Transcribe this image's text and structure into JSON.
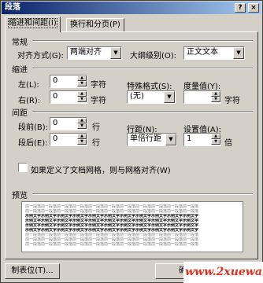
{
  "title": "段落",
  "window_buttons": {
    "help": "?",
    "close": "×"
  },
  "tabs": [
    {
      "label": "缩进和间距(I)"
    },
    {
      "label": "换行和分页(P)"
    }
  ],
  "general": {
    "heading": "常规",
    "alignment_label": "对齐方式(G):",
    "alignment_value": "两端对齐",
    "outline_label": "大纲级别(O):",
    "outline_value": "正文文本"
  },
  "indent": {
    "heading": "缩进",
    "left_label": "左(L):",
    "left_value": "0",
    "left_unit": "字符",
    "right_label": "右(R):",
    "right_value": "0",
    "right_unit": "字符",
    "special_label": "特殊格式(S):",
    "special_value": "(无)",
    "measure_label": "度量值(Y):",
    "measure_value": "",
    "measure_unit": "字符"
  },
  "spacing": {
    "heading": "间距",
    "before_label": "段前(B):",
    "before_value": "0",
    "before_unit": "行",
    "after_label": "段后(E):",
    "after_value": "0",
    "after_unit": "行",
    "line_label": "行距(N):",
    "line_value": "单倍行距",
    "at_label": "设置值(A):",
    "at_value": "1",
    "at_unit": "倍"
  },
  "grid_checkbox": {
    "label": "如果定义了文档网格，则与网格对齐(W)",
    "checked": false
  },
  "preview": {
    "heading": "预览",
    "gray_text": "前一段落前一段落前一段落前一段落前一段落前一段落前一段落前一段落前一段落前一段落前一段落",
    "dark_text": "示例文字示例文字示例文字示例文字示例文字示例文字示例文字示例文字示例文字示例文字示例文字"
  },
  "buttons": {
    "tabs_button": "制表位(T)...",
    "ok_button": "确"
  },
  "watermark": "www.2xuewang.com"
}
